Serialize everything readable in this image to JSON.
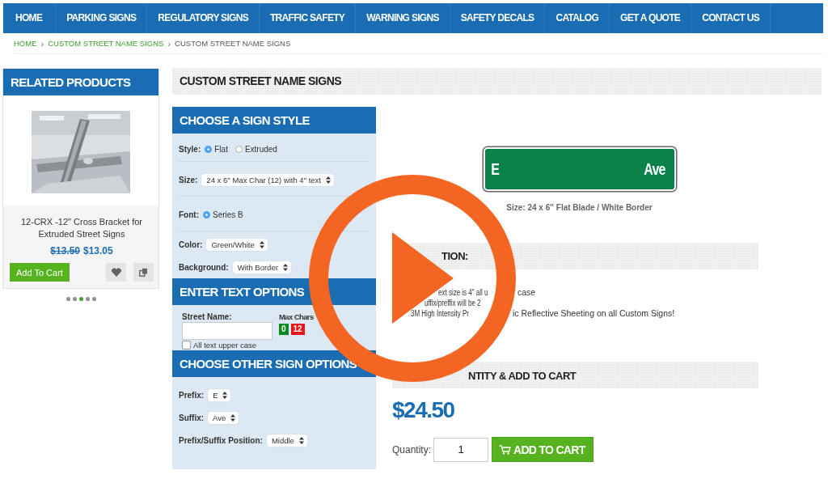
{
  "nav": [
    {
      "label": "HOME"
    },
    {
      "label": "PARKING SIGNS"
    },
    {
      "label": "REGULATORY SIGNS"
    },
    {
      "label": "TRAFFIC SAFETY"
    },
    {
      "label": "WARNING SIGNS"
    },
    {
      "label": "SAFETY DECALS"
    },
    {
      "label": "CATALOG"
    },
    {
      "label": "GET A QUOTE"
    },
    {
      "label": "CONTACT US"
    }
  ],
  "breadcrumb_separator": "›",
  "breadcrumb": [
    {
      "label": "HOME",
      "kind": "link"
    },
    {
      "label": "CUSTOM STREET NAME SIGNS",
      "kind": "link"
    },
    {
      "label": "CUSTOM STREET NAME SIGNS",
      "kind": "current"
    }
  ],
  "related": {
    "title": "RELATED PRODUCTS",
    "product": {
      "kind": "picture",
      "name": "12-CRX -12\" Cross Bracket for Extruded Street Signs",
      "old_price": "$13.50",
      "price": "$13.05",
      "add_button": "Add To Cart"
    },
    "dots": [
      {
        "selected": false
      },
      {
        "selected": false
      },
      {
        "selected": true
      },
      {
        "selected": false
      },
      {
        "selected": false
      }
    ]
  },
  "page_title": "CUSTOM STREET NAME SIGNS",
  "sign_style": {
    "title": "CHOOSE A SIGN STYLE",
    "fields": [
      {
        "kind": "radio",
        "label": "Style:",
        "options": [
          {
            "label": "Flat",
            "selected": true
          },
          {
            "label": "Extruded",
            "selected": false
          }
        ],
        "divider": true
      },
      {
        "kind": "select",
        "label": "Size:",
        "value": "24 x 6'' Max Char (12) with 4\" text",
        "divider": true
      },
      {
        "kind": "radio",
        "label": "Font:",
        "options": [
          {
            "label": "Series B",
            "selected": true
          }
        ],
        "divider": true
      },
      {
        "kind": "select",
        "label": "Color:",
        "value": "Green/White",
        "divider": false
      },
      {
        "kind": "select",
        "label": "Background:",
        "value": "With Border",
        "divider": false
      }
    ]
  },
  "text_options": {
    "title": "ENTER TEXT OPTIONS",
    "street_name": {
      "label": "Street Name:"
    },
    "max_chars": {
      "label": "Max Chars",
      "counts": [
        {
          "value": "0",
          "color": "#0a8a1e"
        },
        {
          "value": "12",
          "color": "#e8141b"
        }
      ]
    },
    "upper_case": {
      "label": "All text upper case",
      "checked": false
    }
  },
  "other_options": {
    "title": "CHOOSE OTHER SIGN OPTIONS",
    "fields": [
      {
        "kind": "select",
        "label": "Prefix:",
        "value": "E"
      },
      {
        "kind": "select",
        "label": "Suffix:",
        "value": "Ave"
      },
      {
        "kind": "select",
        "label": "Prefix/Suffix Position:",
        "value": "Middle"
      }
    ]
  },
  "preview": {
    "left_text": "E",
    "right_text": "Ave",
    "caption": "Size: 24 x 6'' Flat Blade / White Border"
  },
  "description": {
    "title": "TION:",
    "bullets": [
      [
        "ext size is 4\" all u",
        "case"
      ],
      [
        "uffix/preffix will be 2"
      ],
      [
        "3M High Intensity Pr",
        "ic Reflective Sheeting on all Custom Signs!"
      ]
    ]
  },
  "purchase": {
    "title": "NTITY & ADD TO CART",
    "price": "$24.50",
    "quantity_label": "Quantity:",
    "quantity": "1",
    "button": "ADD TO CART"
  }
}
